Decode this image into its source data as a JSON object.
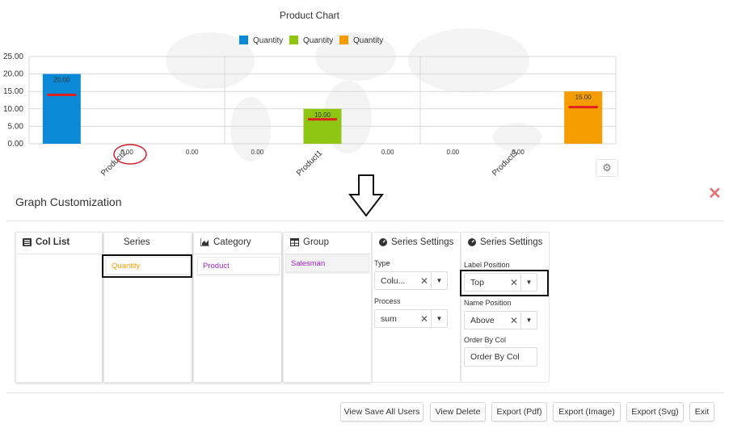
{
  "chart_data": {
    "type": "bar",
    "title": "Product Chart",
    "categories": [
      "Product2",
      "Product1",
      "Product3"
    ],
    "series": [
      {
        "name": "Quantity",
        "color": "#0a8ad6",
        "values": [
          20,
          0,
          0
        ]
      },
      {
        "name": "Quantity",
        "color": "#8fc614",
        "values": [
          0,
          10,
          0
        ]
      },
      {
        "name": "Quantity",
        "color": "#f59c00",
        "values": [
          0,
          0,
          15
        ]
      }
    ],
    "value_labels": [
      "20.00",
      "0.00",
      "0.00",
      "0.00",
      "10.00",
      "0.00",
      "0.00",
      "0.00",
      "15.00"
    ],
    "y_ticks": [
      "0.00",
      "5.00",
      "10.00",
      "15.00",
      "20.00",
      "25.00"
    ],
    "ylim": [
      0,
      25
    ],
    "legend_position": "top-center",
    "grid": true,
    "target_marker_color": "#e0201f"
  },
  "customization": {
    "title": "Graph Customization",
    "close_icon": "✕",
    "gear_icon": "⚙",
    "columns": {
      "col_list": {
        "label": "Col List",
        "icon": "list-icon"
      },
      "series": {
        "label": "Series",
        "item": "Quantity"
      },
      "category": {
        "label": "Category",
        "icon": "area-chart-icon",
        "item": "Product"
      },
      "group": {
        "label": "Group",
        "icon": "table-icon",
        "item": "Salesman"
      }
    },
    "series_settings_1": {
      "label": "Series Settings",
      "type_label": "Type",
      "type_value": "Colu...",
      "process_label": "Process",
      "process_value": "sum"
    },
    "series_settings_2": {
      "label": "Series Settings",
      "label_position_label": "Label Position",
      "label_position_value": "Top",
      "name_position_label": "Name Position",
      "name_position_value": "Above",
      "order_by_label": "Order By Col",
      "order_by_placeholder": "Order By Col"
    }
  },
  "buttons": {
    "view_save_all_users": "View Save All Users",
    "view_delete": "View Delete",
    "export_pdf": "Export (Pdf)",
    "export_image": "Export (Image)",
    "export_svg": "Export (Svg)",
    "exit": "Exit"
  },
  "colors": {
    "chip_series": "#f59c00",
    "chip_category": "#a020c8",
    "chip_group": "#a020c8"
  }
}
